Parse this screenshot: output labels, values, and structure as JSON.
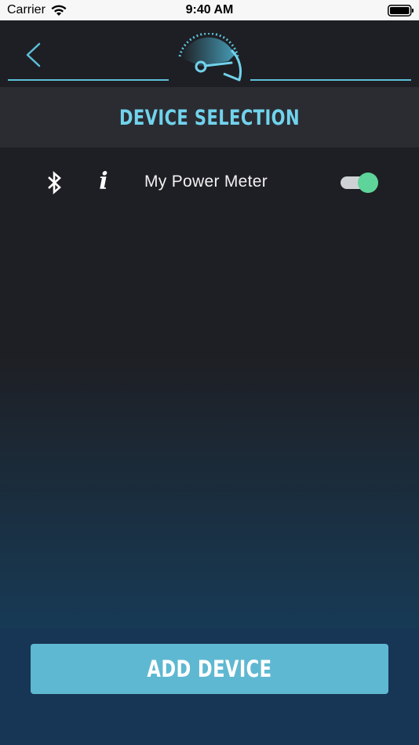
{
  "status_bar": {
    "carrier": "Carrier",
    "time": "9:40 AM",
    "wifi_icon": "wifi-icon",
    "battery_icon": "battery-full-icon"
  },
  "header": {
    "back_icon": "chevron-left-icon",
    "logo_icon": "speedometer-gauge-icon"
  },
  "title_bar": {
    "title": "DEVICE SELECTION"
  },
  "devices": [
    {
      "name": "My Power Meter",
      "connection_icon": "bluetooth-icon",
      "info_icon": "info-icon",
      "enabled": true
    }
  ],
  "footer": {
    "add_button_label": "ADD DEVICE"
  },
  "colors": {
    "accent": "#71d3ec",
    "button": "#5fb8d1",
    "toggle_on": "#5fd49a",
    "background_top": "#1e1f24",
    "background_bottom": "#173a55"
  }
}
